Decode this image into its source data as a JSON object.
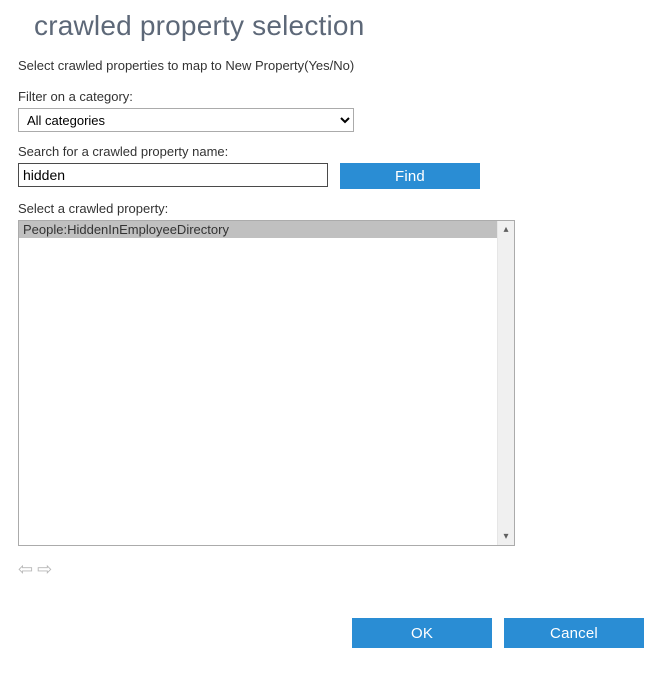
{
  "title": "crawled property selection",
  "intro": "Select crawled properties to map to New Property(Yes/No)",
  "filter": {
    "label": "Filter on a category:",
    "selected": "All categories"
  },
  "search": {
    "label": "Search for a crawled property name:",
    "value": "hidden",
    "find_button": "Find"
  },
  "select_label": "Select a crawled property:",
  "results": [
    "People:HiddenInEmployeeDirectory"
  ],
  "buttons": {
    "ok": "OK",
    "cancel": "Cancel"
  }
}
